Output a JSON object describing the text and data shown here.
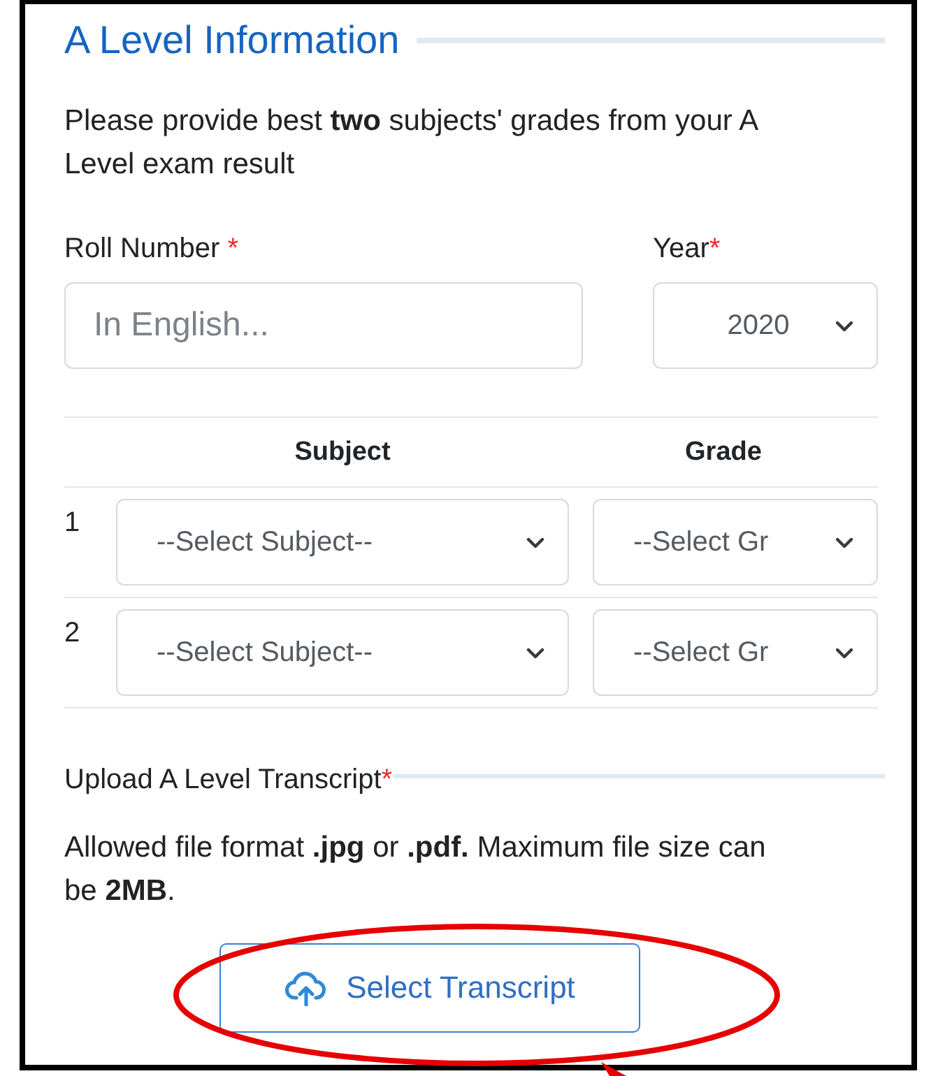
{
  "section": {
    "title": "A Level Information"
  },
  "intro": "Please provide best **two** subjects' grades from your A Level exam result",
  "roll_number": {
    "label": "Roll Number",
    "required_mark": "*",
    "placeholder": "In English..."
  },
  "year": {
    "label": "Year",
    "required_mark": "*",
    "value": "2020"
  },
  "table": {
    "columns": [
      "Subject",
      "Grade"
    ],
    "rows": [
      {
        "index": "1",
        "subject": "--Select Subject--",
        "grade": "--Select Gr"
      },
      {
        "index": "2",
        "subject": "--Select Subject--",
        "grade": "--Select Gr"
      }
    ]
  },
  "upload": {
    "label": "Upload A Level Transcript",
    "required_mark": "*",
    "note": "Allowed file format **.jpg** or **.pdf.** Maximum file size can be **2MB**.",
    "button": "Select Transcript"
  },
  "annotation": {
    "ellipse": true,
    "arrow": true
  }
}
